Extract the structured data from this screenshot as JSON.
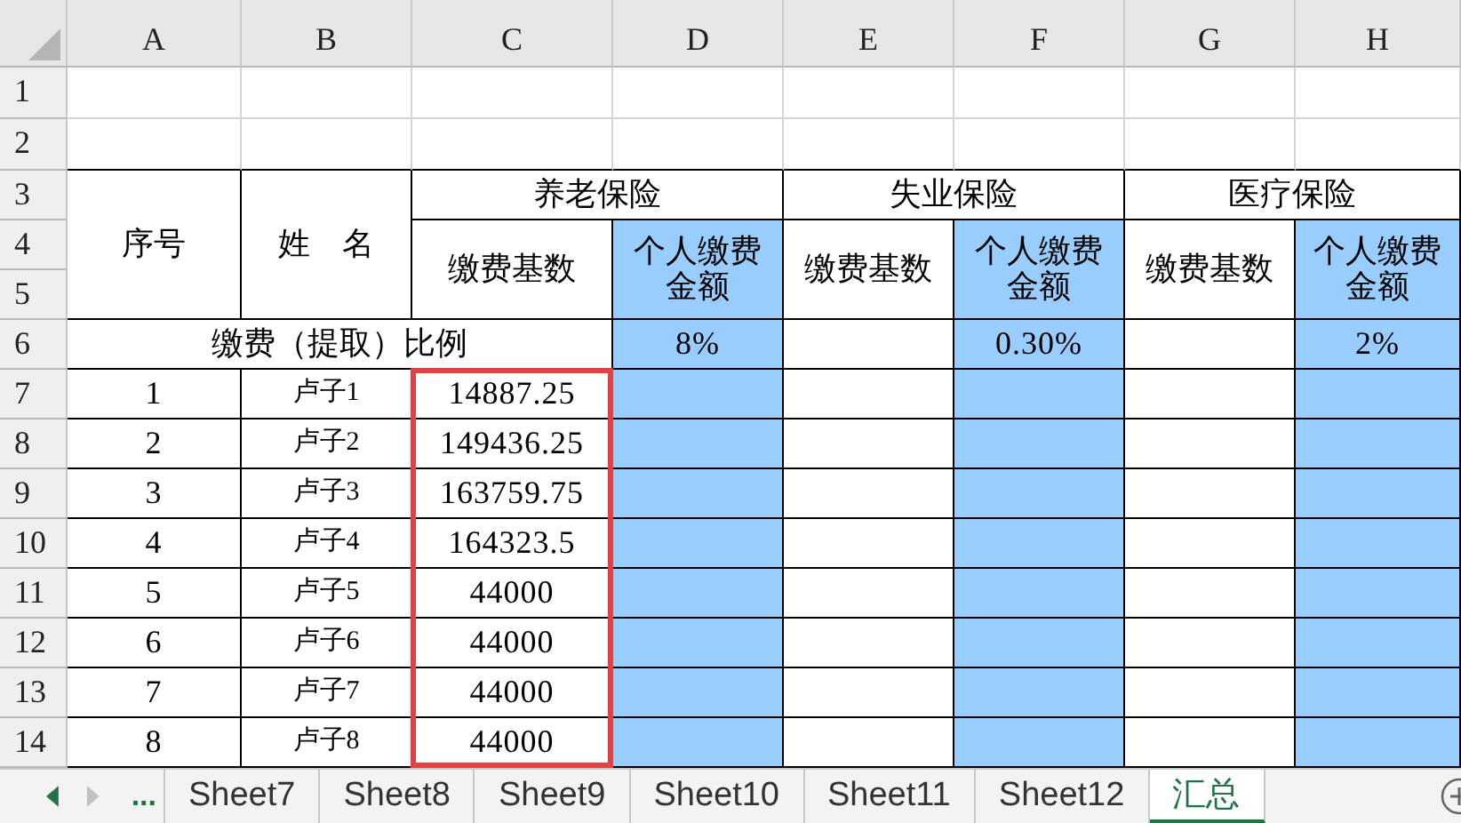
{
  "column_headers": [
    "A",
    "B",
    "C",
    "D",
    "E",
    "F",
    "G",
    "H"
  ],
  "row_headers": [
    "1",
    "2",
    "3",
    "4",
    "5",
    "6",
    "7",
    "8",
    "9",
    "10",
    "11",
    "12",
    "13",
    "14"
  ],
  "table": {
    "seq_label": "序号",
    "name_label": "姓　名",
    "rate_label": "缴费（提取）比例",
    "groups": [
      {
        "title": "养老保险",
        "base_label": "缴费基数",
        "amount_label": "个人缴费金额",
        "rate": "8%",
        "amount_shaded": true
      },
      {
        "title": "失业保险",
        "base_label": "缴费基数",
        "amount_label": "个人缴费金额",
        "rate": "0.30%",
        "amount_shaded": true
      },
      {
        "title": "医疗保险",
        "base_label": "缴费基数",
        "amount_label": "个人缴费金额",
        "rate": "2%",
        "amount_shaded": true
      }
    ],
    "rows": [
      {
        "no": "1",
        "name": "卢子1",
        "base": "14887.25"
      },
      {
        "no": "2",
        "name": "卢子2",
        "base": "149436.25"
      },
      {
        "no": "3",
        "name": "卢子3",
        "base": "163759.75"
      },
      {
        "no": "4",
        "name": "卢子4",
        "base": "164323.5"
      },
      {
        "no": "5",
        "name": "卢子5",
        "base": "44000"
      },
      {
        "no": "6",
        "name": "卢子6",
        "base": "44000"
      },
      {
        "no": "7",
        "name": "卢子7",
        "base": "44000"
      },
      {
        "no": "8",
        "name": "卢子8",
        "base": "44000"
      }
    ],
    "base_column_outlined": true
  },
  "sheet_tabs": {
    "more": "...",
    "tabs": [
      {
        "label": "Sheet7",
        "selected": false
      },
      {
        "label": "Sheet8",
        "selected": false
      },
      {
        "label": "Sheet9",
        "selected": false
      },
      {
        "label": "Sheet10",
        "selected": false
      },
      {
        "label": "Sheet11",
        "selected": false
      },
      {
        "label": "Sheet12",
        "selected": false
      },
      {
        "label": "汇总",
        "selected": true
      }
    ]
  }
}
